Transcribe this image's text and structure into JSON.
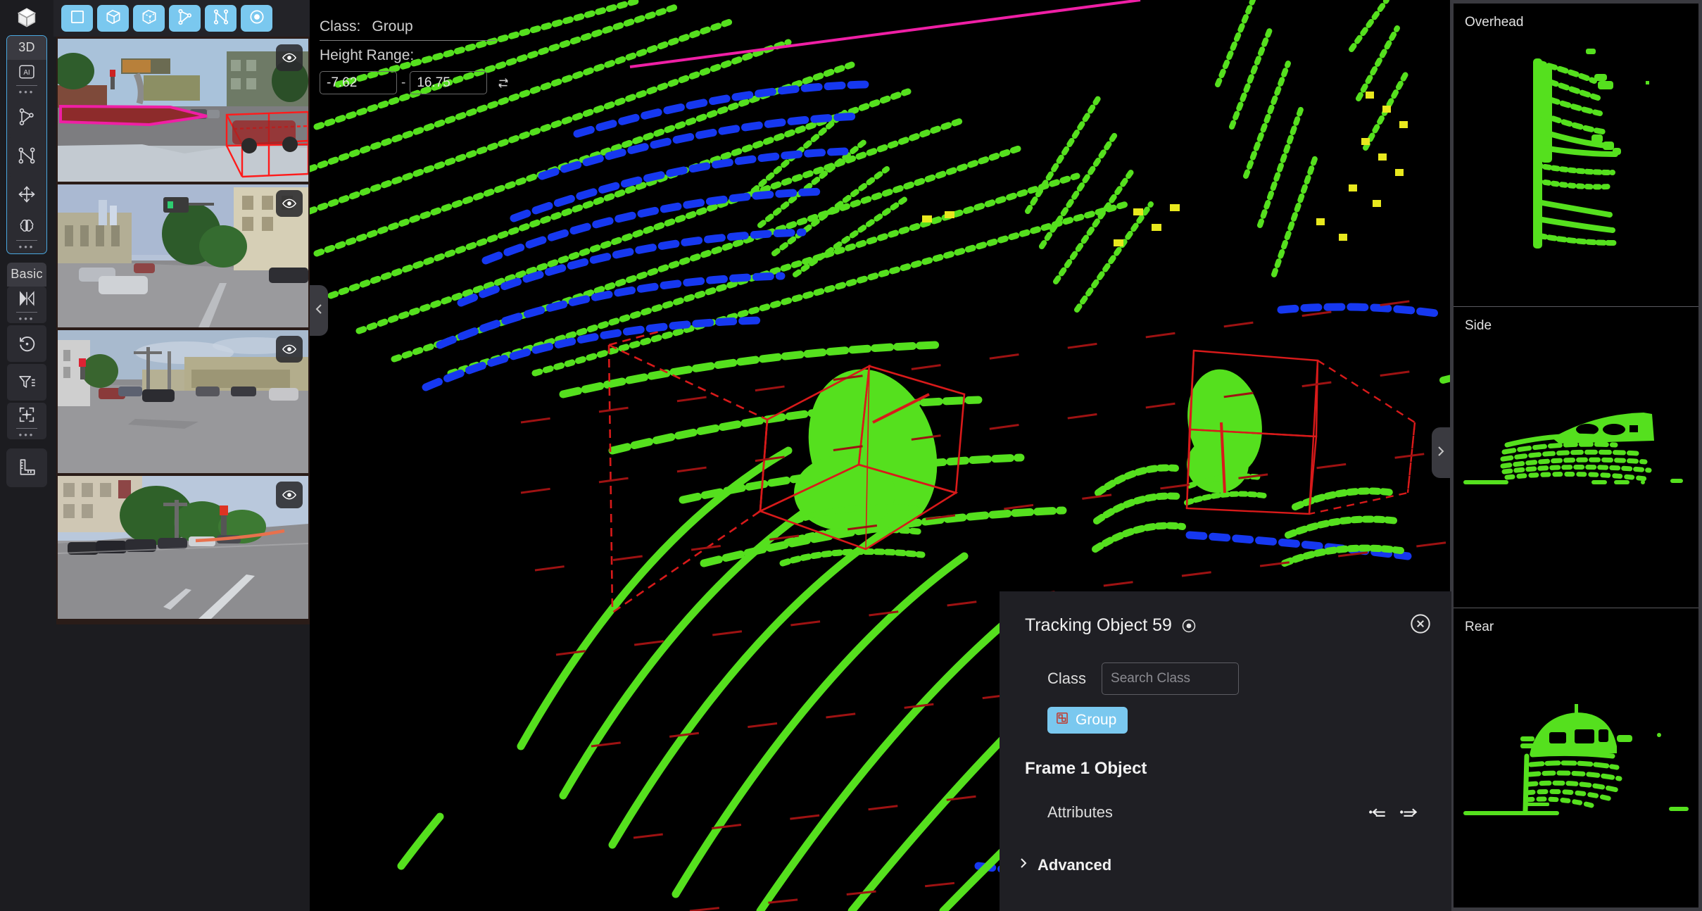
{
  "left_rail": {
    "logo_icon": "cube-logo-icon",
    "groups": [
      {
        "label": "3D",
        "items": [
          {
            "name": "ai-assist",
            "icon": "ai-box-icon",
            "has_more": true
          },
          {
            "name": "polygon-tool",
            "icon": "polygon-icon",
            "has_more": false
          },
          {
            "name": "polyline-tool",
            "icon": "polyline-icon",
            "has_more": false
          },
          {
            "name": "move-tool",
            "icon": "move-arrows-icon",
            "has_more": false
          },
          {
            "name": "segmentation-tool",
            "icon": "brain-icon",
            "has_more": true
          }
        ]
      },
      {
        "label": "Basic",
        "items": [
          {
            "name": "playback-tool",
            "icon": "play-compare-icon",
            "has_more": true
          },
          {
            "name": "undo-rotate-tool",
            "icon": "rotate-undo-icon",
            "has_more": false
          },
          {
            "name": "filter-tool",
            "icon": "funnel-icon",
            "has_more": false
          },
          {
            "name": "focus-tool",
            "icon": "crosshair-focus-icon",
            "has_more": true
          }
        ]
      },
      {
        "label": "",
        "items": [
          {
            "name": "measure-tool",
            "icon": "ruler-icon",
            "has_more": false
          }
        ]
      }
    ]
  },
  "top_toolbar": {
    "buttons": [
      {
        "name": "rectangle-tool",
        "icon": "square-icon"
      },
      {
        "name": "cuboid-tool",
        "icon": "cube-wireframe-icon"
      },
      {
        "name": "cuboid-face-tool",
        "icon": "cube-face-icon"
      },
      {
        "name": "polygon-tool",
        "icon": "polygon-icon"
      },
      {
        "name": "polyline-tool",
        "icon": "polyline-icon"
      },
      {
        "name": "point-tool",
        "icon": "dot-circle-icon"
      }
    ]
  },
  "cameras": [
    {
      "name": "camera-front",
      "eye_icon": "eye-icon"
    },
    {
      "name": "camera-front-left",
      "eye_icon": "eye-icon"
    },
    {
      "name": "camera-side-left",
      "eye_icon": "eye-icon"
    },
    {
      "name": "camera-rear-left",
      "eye_icon": "eye-icon"
    }
  ],
  "viewport_hud": {
    "class_label": "Class:",
    "class_value": "Group",
    "height_range_label": "Height Range:",
    "height_min": "-7.62",
    "height_max": "16.75",
    "range_separator": "-",
    "link_icon": "link-range-icon",
    "collapse_left_icon": "chevron-left-icon",
    "expand_right_icon": "chevron-right-icon"
  },
  "detail_panel": {
    "title": "Tracking Object 59",
    "visibility_icon": "eye-icon",
    "close_icon": "close-circle-icon",
    "class_label": "Class",
    "class_search_placeholder": "Search Class",
    "class_search_value": "",
    "chip": {
      "label": "Group",
      "icon": "group-shapes-icon"
    },
    "frame_heading": "Frame 1 Object",
    "attributes_label": "Attributes",
    "copy_prev_icon": "copy-to-previous-icon",
    "copy_next_icon": "copy-to-next-icon",
    "advanced_label": "Advanced",
    "advanced_chevron": "chevron-right-icon"
  },
  "right_previews": [
    {
      "name": "preview-overhead",
      "label": "Overhead"
    },
    {
      "name": "preview-side",
      "label": "Side"
    },
    {
      "name": "preview-rear",
      "label": "Rear"
    }
  ],
  "colors": {
    "accent": "#7ac8ef",
    "point_green": "#55e01e",
    "point_blue": "#1638f0",
    "box_red": "#d81a1a",
    "overlay_magenta": "#ef1fa5",
    "panel_bg": "#1f1f24"
  }
}
